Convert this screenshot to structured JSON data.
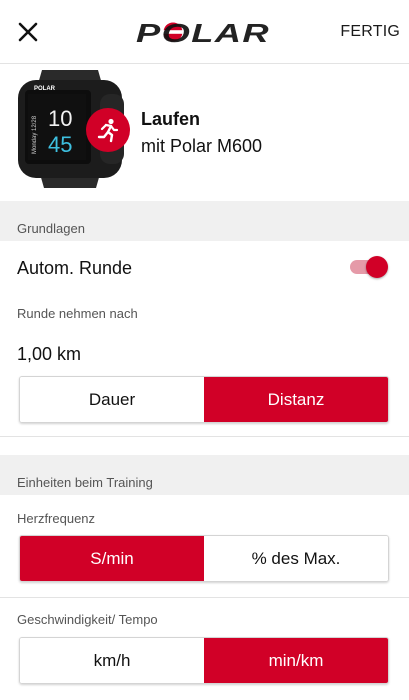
{
  "header": {
    "logo_text": "POLAR",
    "done_label": "FERTIG"
  },
  "hero": {
    "title": "Laufen",
    "subtitle": "mit Polar M600",
    "watch": {
      "brand": "POLAR",
      "date": "Monday 12/28",
      "hour": "10",
      "minute": "45"
    }
  },
  "sections": {
    "basics": {
      "header": "Grundlagen",
      "auto_lap_label": "Autom. Runde",
      "auto_lap_on": true,
      "lap_after_label": "Runde nehmen nach",
      "lap_after_value": "1,00 km",
      "lap_mode": {
        "options": [
          "Dauer",
          "Distanz"
        ],
        "selected": "Distanz"
      }
    },
    "units": {
      "header": "Einheiten beim Training",
      "heart_rate_label": "Herzfrequenz",
      "heart_rate_mode": {
        "options": [
          "S/min",
          "% des Max."
        ],
        "selected": "S/min"
      },
      "speed_label": "Geschwindigkeit/ Tempo",
      "speed_mode": {
        "options": [
          "km/h",
          "min/km"
        ],
        "selected": "min/km"
      }
    }
  },
  "colors": {
    "accent": "#d10027",
    "toggle_track": "#e59aa8",
    "section_bg": "#f0f0f0"
  },
  "icons": {
    "close": "close-icon",
    "sport": "running-icon"
  }
}
